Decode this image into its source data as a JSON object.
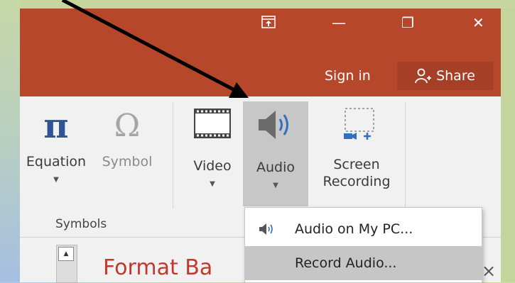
{
  "titlebar": {
    "restore_ribbon_icon": "ribbon-display-icon",
    "minimize_glyph": "—",
    "restore_glyph": "❐",
    "close_glyph": "✕",
    "sign_in": "Sign in",
    "share": "Share",
    "background_color": "#b7472a"
  },
  "ribbon": {
    "commands": [
      {
        "label": "Equation",
        "icon": "pi-icon",
        "has_dropdown": true
      },
      {
        "label": "Symbol",
        "icon": "omega-icon",
        "has_dropdown": false
      },
      {
        "label": "Video",
        "icon": "film-icon",
        "has_dropdown": true
      },
      {
        "label": "Audio",
        "icon": "speaker-icon",
        "has_dropdown": true,
        "active": true
      },
      {
        "label": "Screen",
        "label2": "Recording",
        "icon": "screen-recording-icon",
        "has_dropdown": false
      }
    ],
    "group_label": "Symbols",
    "collapse_glyph": "^",
    "equation_glyph": "π",
    "symbol_glyph": "Ω",
    "caret_glyph": "▼"
  },
  "audio_menu": {
    "items": [
      {
        "label": "Audio on My PC...",
        "icon": "speaker-small-icon"
      },
      {
        "label": "Record Audio...",
        "icon": "",
        "highlighted": true
      }
    ]
  },
  "pane": {
    "title_partial": "Format Ba",
    "close_glyph": "×",
    "scroll_up_glyph": "▲"
  }
}
